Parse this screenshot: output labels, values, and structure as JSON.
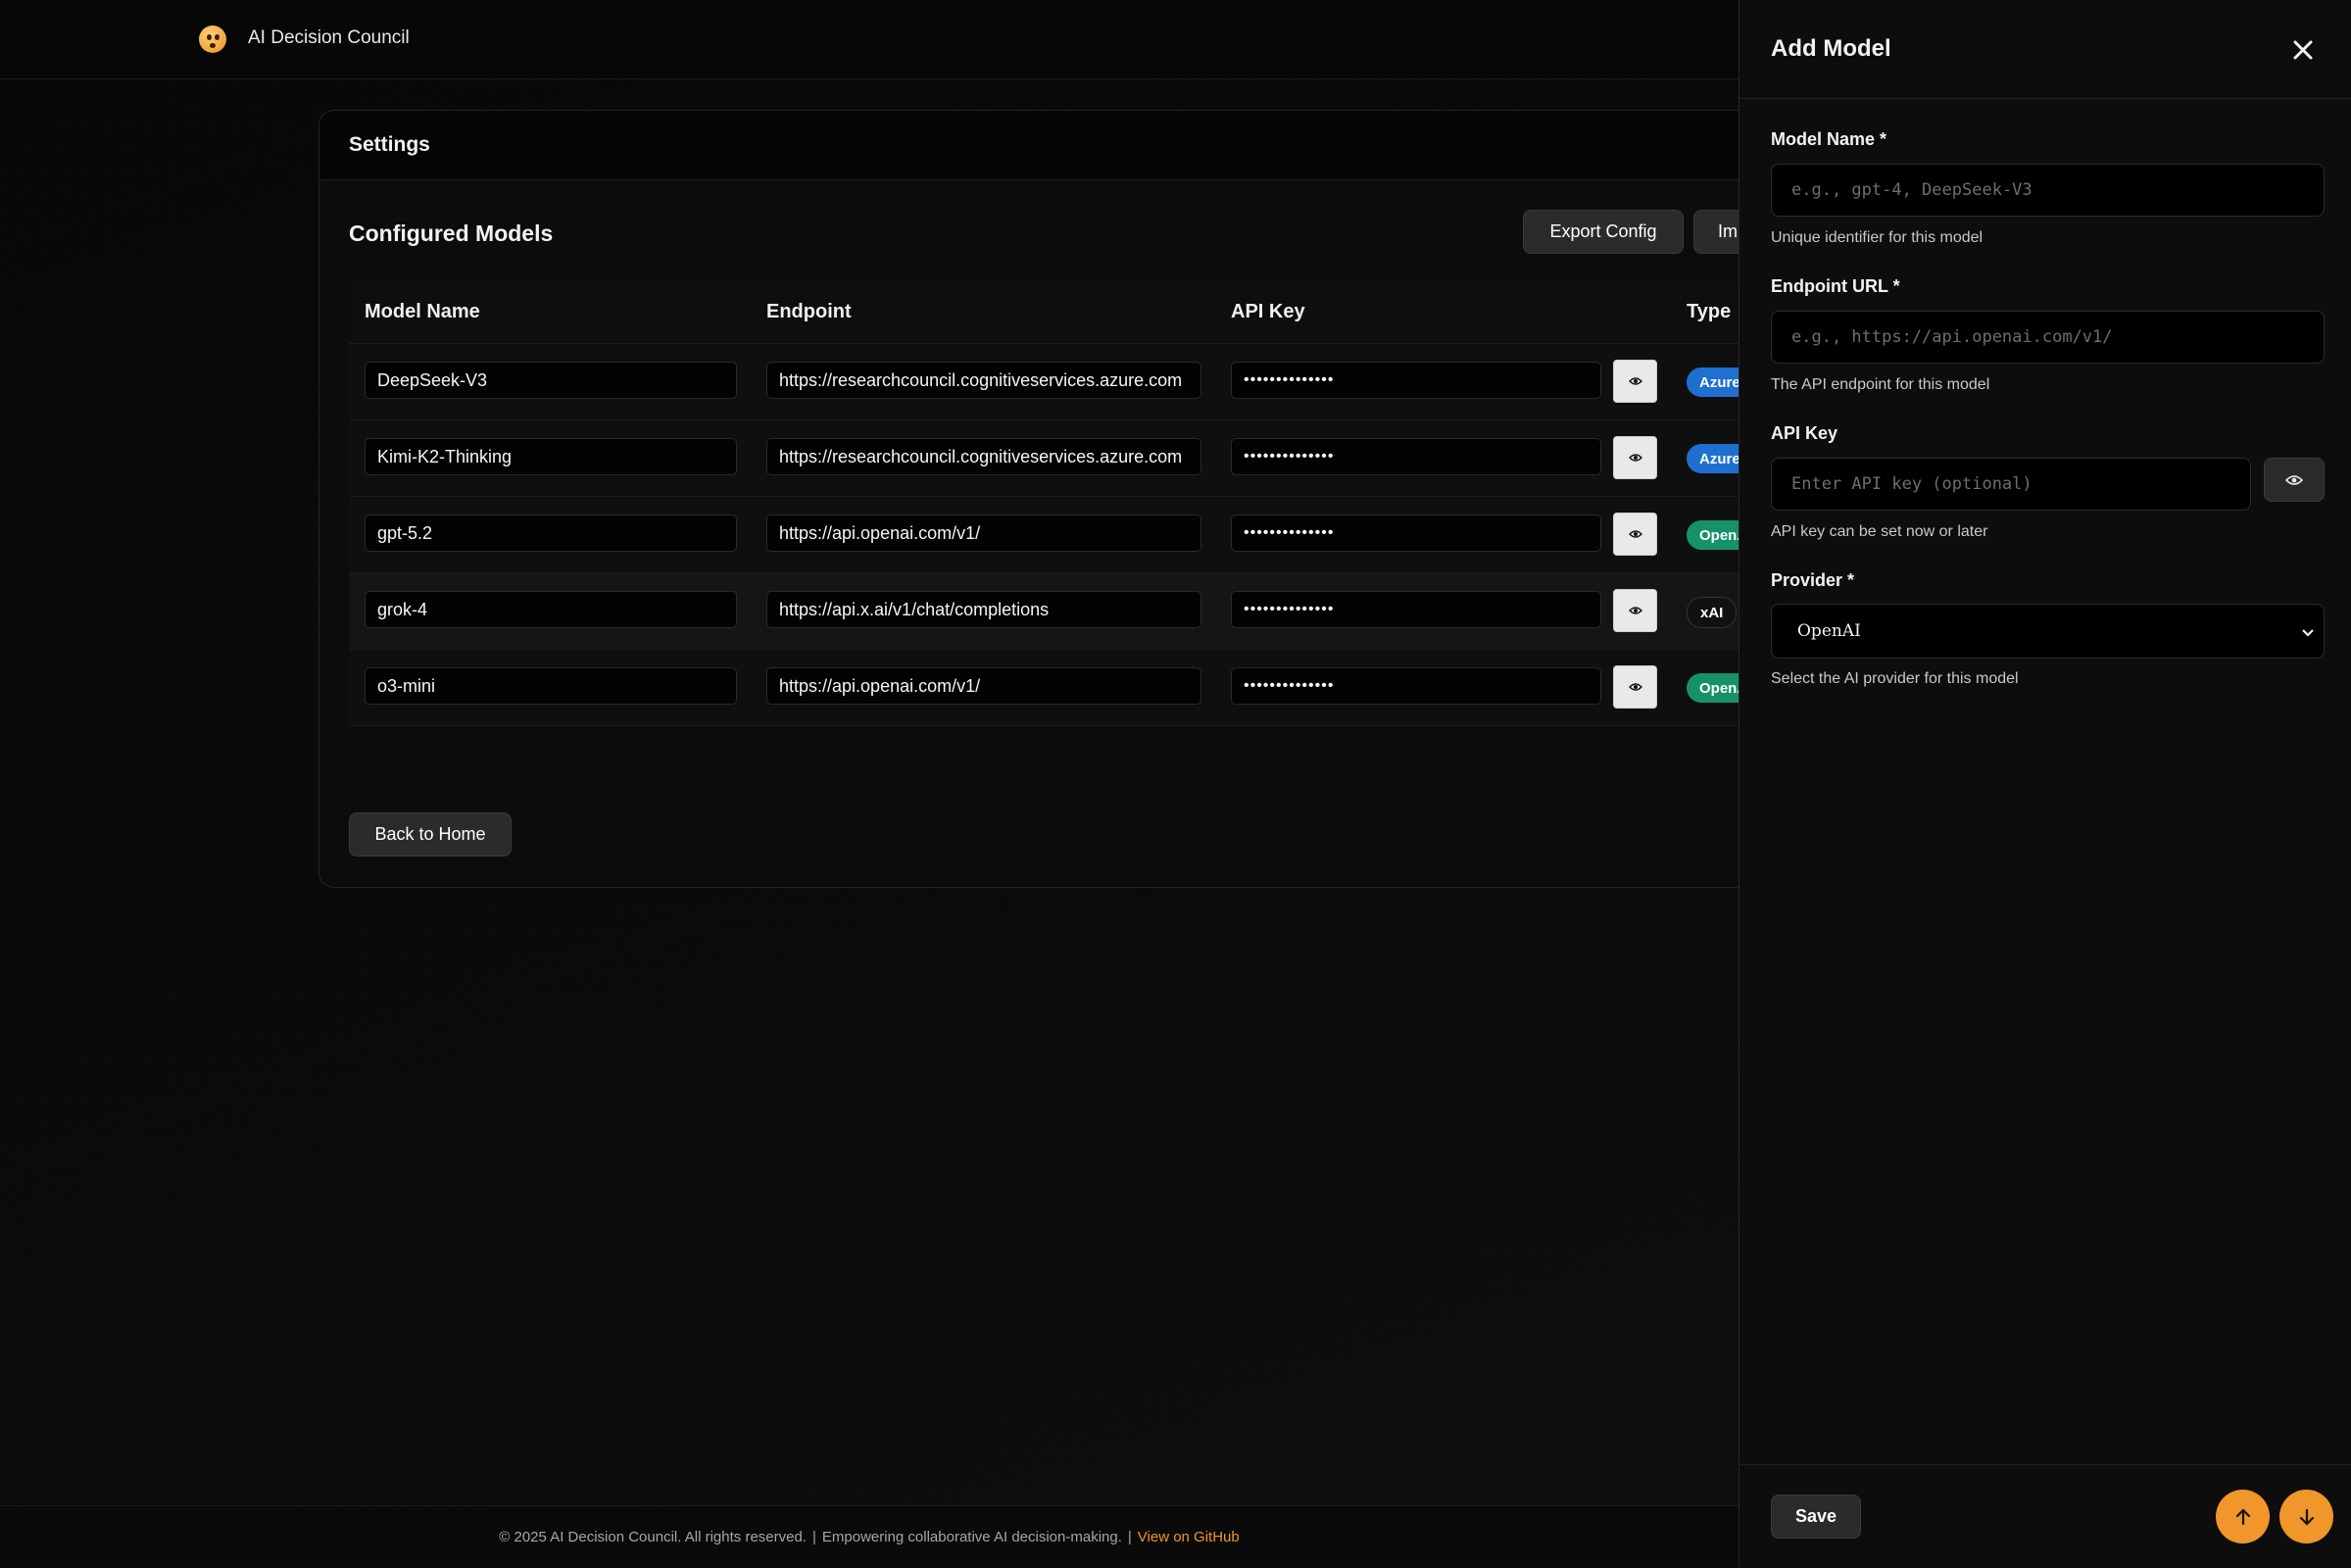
{
  "app": {
    "title": "AI Decision Council"
  },
  "settings": {
    "header": "Settings",
    "section_title": "Configured Models",
    "export_label": "Export Config",
    "import_label": "Im",
    "back_label": "Back to Home",
    "columns": [
      "Model Name",
      "Endpoint",
      "API Key",
      "Type"
    ],
    "rows": [
      {
        "name": "DeepSeek-V3",
        "endpoint": "https://researchcouncil.cognitiveservices.azure.com",
        "key": "••••••••••••••",
        "type": "Azure",
        "type_color": "#1f6fd1"
      },
      {
        "name": "Kimi-K2-Thinking",
        "endpoint": "https://researchcouncil.cognitiveservices.azure.com",
        "key": "••••••••••••••",
        "type": "Azure",
        "type_color": "#1f6fd1"
      },
      {
        "name": "gpt-5.2",
        "endpoint": "https://api.openai.com/v1/",
        "key": "••••••••••••••",
        "type": "OpenAI",
        "type_color": "#16926b"
      },
      {
        "name": "grok-4",
        "endpoint": "https://api.x.ai/v1/chat/completions",
        "key": "••••••••••••••",
        "type": "xAI",
        "type_color": "#111111"
      },
      {
        "name": "o3-mini",
        "endpoint": "https://api.openai.com/v1/",
        "key": "••••••••••••••",
        "type": "OpenAI",
        "type_color": "#16926b"
      }
    ]
  },
  "footer": {
    "copyright": "© 2025 AI Decision Council. All rights reserved.",
    "separator": "|",
    "tagline": "Empowering collaborative AI decision-making.",
    "github": "View on GitHub"
  },
  "panel": {
    "title": "Add Model",
    "model_name": {
      "label": "Model Name *",
      "placeholder": "e.g., gpt-4, DeepSeek-V3",
      "hint": "Unique identifier for this model"
    },
    "endpoint": {
      "label": "Endpoint URL *",
      "placeholder": "e.g., https://api.openai.com/v1/",
      "hint": "The API endpoint for this model"
    },
    "api_key": {
      "label": "API Key",
      "placeholder": "Enter API key (optional)",
      "hint": "API key can be set now or later"
    },
    "provider": {
      "label": "Provider *",
      "value": "OpenAI",
      "hint": "Select the AI provider for this model"
    },
    "save_label": "Save"
  },
  "colors": {
    "accent": "#f0962a",
    "azure": "#1f6fd1",
    "openai": "#16926b"
  }
}
